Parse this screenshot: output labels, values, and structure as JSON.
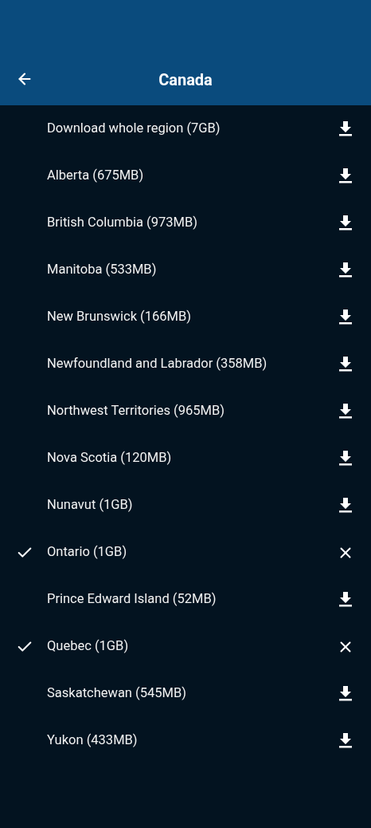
{
  "header": {
    "title": "Canada"
  },
  "regions": [
    {
      "name": "Download whole region (7GB)",
      "downloaded": false
    },
    {
      "name": "Alberta (675MB)",
      "downloaded": false
    },
    {
      "name": "British Columbia (973MB)",
      "downloaded": false
    },
    {
      "name": "Manitoba (533MB)",
      "downloaded": false
    },
    {
      "name": "New Brunswick (166MB)",
      "downloaded": false
    },
    {
      "name": "Newfoundland and Labrador (358MB)",
      "downloaded": false
    },
    {
      "name": "Northwest Territories (965MB)",
      "downloaded": false
    },
    {
      "name": "Nova Scotia (120MB)",
      "downloaded": false
    },
    {
      "name": "Nunavut (1GB)",
      "downloaded": false
    },
    {
      "name": "Ontario (1GB)",
      "downloaded": true
    },
    {
      "name": "Prince Edward Island (52MB)",
      "downloaded": false
    },
    {
      "name": "Quebec (1GB)",
      "downloaded": true
    },
    {
      "name": "Saskatchewan (545MB)",
      "downloaded": false
    },
    {
      "name": "Yukon (433MB)",
      "downloaded": false
    }
  ]
}
